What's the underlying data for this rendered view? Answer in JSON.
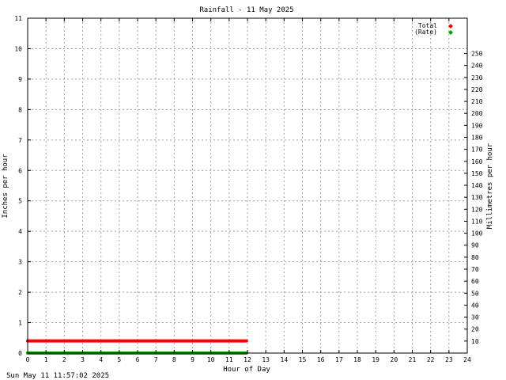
{
  "chart_data": {
    "type": "line",
    "title": "Rainfall - 11 May 2025",
    "xlabel": "Hour of Day",
    "ylabel": "Inches per hour",
    "y2label": "Millimetres per hour",
    "timestamp": "Sun May 11 11:57:02 2025",
    "xlim": [
      0,
      24
    ],
    "ylim": [
      0,
      11
    ],
    "y2lim": [
      0,
      279.4
    ],
    "x_ticks": [
      0,
      1,
      2,
      3,
      4,
      5,
      6,
      7,
      8,
      9,
      10,
      11,
      12,
      13,
      14,
      15,
      16,
      17,
      18,
      19,
      20,
      21,
      22,
      23,
      24
    ],
    "y_ticks": [
      0,
      1,
      2,
      3,
      4,
      5,
      6,
      7,
      8,
      9,
      10,
      11
    ],
    "y2_ticks": [
      10,
      20,
      30,
      40,
      50,
      60,
      70,
      80,
      90,
      100,
      110,
      120,
      130,
      140,
      150,
      160,
      170,
      180,
      190,
      200,
      210,
      220,
      230,
      240,
      250
    ],
    "grid": true,
    "legend_position": "top-right",
    "series": [
      {
        "name": "Total",
        "color": "#ff0000",
        "x": [
          0,
          11.95
        ],
        "y": [
          0.4,
          0.4
        ]
      },
      {
        "name": "(Rate)",
        "color": "#00a000",
        "x": [
          0,
          11.95
        ],
        "y": [
          0.0,
          0.0
        ]
      }
    ]
  }
}
